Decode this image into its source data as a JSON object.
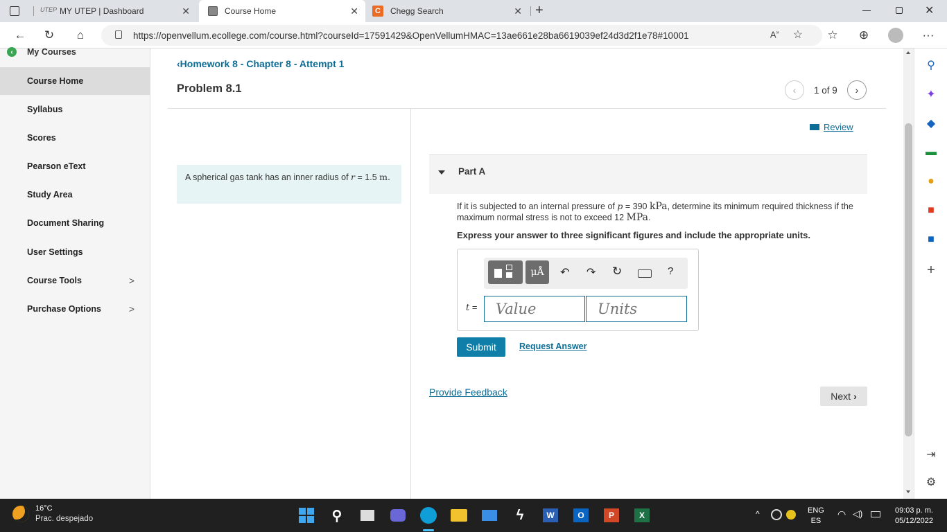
{
  "browser": {
    "tabs": [
      {
        "title": "MY UTEP | Dashboard",
        "favicon": "utep-logo-icon"
      },
      {
        "title": "Course Home",
        "favicon": "page-icon"
      },
      {
        "title": "Chegg Search",
        "favicon": "chegg-icon"
      }
    ],
    "url": "https://openvellum.ecollege.com/course.html?courseId=17591429&OpenVellumHMAC=13ae661e28ba6619039ef24d3d2f1e78#10001"
  },
  "sidebar": {
    "my_courses": "My Courses",
    "items": [
      {
        "label": "Course Home",
        "active": true
      },
      {
        "label": "Syllabus"
      },
      {
        "label": "Scores"
      },
      {
        "label": "Pearson eText"
      },
      {
        "label": "Study Area"
      },
      {
        "label": "Document Sharing"
      },
      {
        "label": "User Settings"
      },
      {
        "label": "Course Tools",
        "chevron": ">"
      },
      {
        "label": "Purchase Options",
        "chevron": ">"
      }
    ]
  },
  "header": {
    "back_link": "Homework 8 - Chapter 8 - Attempt 1",
    "problem_title": "Problem 8.1",
    "pager": "1 of 9"
  },
  "problem": {
    "statement_pre": "A spherical gas tank has an inner radius of",
    "statement_var": "r",
    "statement_eq": " = 1.5",
    "statement_unit": "m."
  },
  "review_label": "Review",
  "part": {
    "title": "Part A",
    "q_pre": "If it is subjected to an internal pressure of",
    "q_var": "p",
    "q_val": " = 390 ",
    "q_unit1": "kPa",
    "q_mid": ", determine its minimum required thickness if the maximum normal stress is not to exceed 12 ",
    "q_unit2": "MPa",
    "q_end": ".",
    "instruction": "Express your answer to three significant figures and include the appropriate units.",
    "answer_var": "t",
    "answer_eq": " =",
    "value_placeholder": "Value",
    "units_placeholder": "Units",
    "toolbar_units_label": "μÅ",
    "toolbar_help": "?",
    "submit": "Submit",
    "request_answer": "Request Answer"
  },
  "footer": {
    "feedback": "Provide Feedback",
    "next": "Next"
  },
  "taskbar": {
    "weather_temp": "16°C",
    "weather_desc": "Prac. despejado",
    "lang1": "ENG",
    "lang2": "ES",
    "time": "09:03 p. m.",
    "date": "05/12/2022"
  },
  "colors": {
    "accent": "#0d6d97",
    "problem_bg": "#e6f4f5",
    "submit_bg": "#0f7ea8",
    "taskbar_bg": "#202020"
  }
}
